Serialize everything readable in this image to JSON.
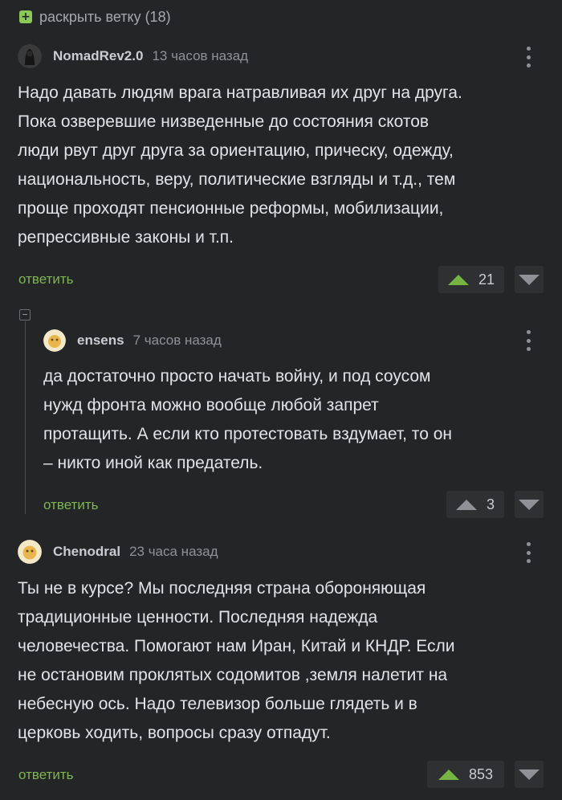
{
  "expand": {
    "label": "раскрыть ветку (18)"
  },
  "comments": [
    {
      "author": "NomadRev2.0",
      "time": "13 часов назад",
      "text": "Надо давать людям врага натравливая их друг на друга.\nПока озверевшие низведенные до состояния скотов\nлюди рвут друг друга за ориентацию, прическу, одежду,\nнациональность, веру, политические взгляды и т.д., тем\nпроще проходят пенсионные реформы, мобилизации,\nрепрессивные законы и т.п.",
      "reply": "ответить",
      "score": "21"
    },
    {
      "author": "ensens",
      "time": "7 часов назад",
      "text": "да достаточно просто начать войну, и под соусом\nнужд фронта можно вообще любой запрет\nпротащить. А если кто протестовать вздумает, то он\n– никто иной как предатель.",
      "reply": "ответить",
      "score": "3"
    },
    {
      "author": "Chenodral",
      "time": "23 часа назад",
      "text": "Ты не в курсе? Мы последняя страна обороняющая\nтрадиционные ценности. Последняя надежда\nчеловечества. Помогают нам Иран, Китай и КНДР. Если\nне остановим проклятых содомитов ,земля налетит на\nнебесную ось. Надо телевизор больше глядеть и в\nцерковь ходить, вопросы сразу отпадут.",
      "reply": "ответить",
      "score": "853"
    }
  ]
}
